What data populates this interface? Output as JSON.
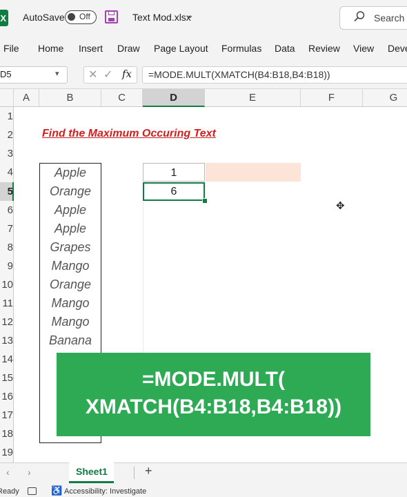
{
  "titlebar": {
    "app_icon_letter": "X",
    "autosave_label": "AutoSave",
    "autosave_state": "Off",
    "file_name": "Text Mod.xlsx",
    "file_chevron": "⌄",
    "search_placeholder": "Search"
  },
  "ribbon": {
    "tabs": [
      "File",
      "Home",
      "Insert",
      "Draw",
      "Page Layout",
      "Formulas",
      "Data",
      "Review",
      "View",
      "Deve"
    ]
  },
  "formula_bar": {
    "name_box": "D5",
    "cancel_glyph": "✕",
    "enter_glyph": "✓",
    "fx_label": "fx",
    "formula": "=MODE.MULT(XMATCH(B4:B18,B4:B18))"
  },
  "grid": {
    "columns": [
      "A",
      "B",
      "C",
      "D",
      "E",
      "F",
      "G"
    ],
    "selected_column": "D",
    "rows": [
      "1",
      "2",
      "3",
      "4",
      "5",
      "6",
      "7",
      "8",
      "9",
      "10",
      "11",
      "12",
      "13",
      "14",
      "15",
      "16",
      "17",
      "18",
      "19"
    ],
    "selected_row": "5",
    "heading": "Find the Maximum Occuring Text",
    "fruits": [
      "Apple",
      "Orange",
      "Apple",
      "Apple",
      "Grapes",
      "Mango",
      "Orange",
      "Mango",
      "Mango",
      "Banana"
    ],
    "results": [
      "1",
      "6"
    ]
  },
  "banner": {
    "line1": "=MODE.MULT(",
    "line2": "XMATCH(B4:B18,B4:B18))"
  },
  "sheets": {
    "tabs": [
      "Sheet1"
    ],
    "add_label": "+",
    "prev": "‹",
    "next": "›"
  },
  "status": {
    "ready": "Ready",
    "accessibility": "Accessibility: Investigate"
  },
  "colors": {
    "excel_green": "#107c41",
    "banner_green": "#2eaa55",
    "heading_red": "#d11e1e",
    "highlight": "#fce4d9"
  }
}
